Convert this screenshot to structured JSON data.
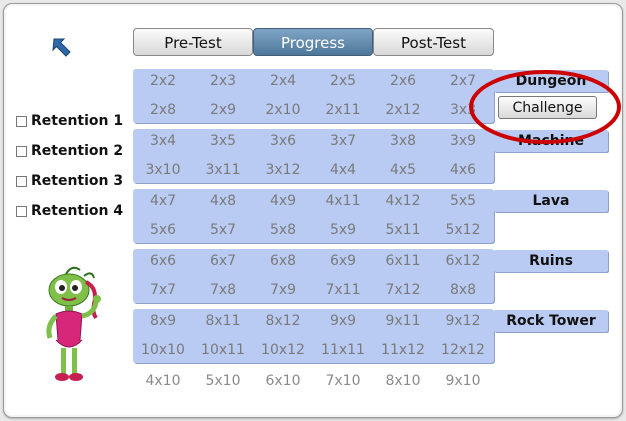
{
  "tabs": [
    {
      "label": "Pre-Test",
      "active": false
    },
    {
      "label": "Progress",
      "active": true
    },
    {
      "label": "Post-Test",
      "active": false
    }
  ],
  "retention": [
    "Retention 1",
    "Retention 2",
    "Retention 3",
    "Retention 4"
  ],
  "groups": [
    {
      "label": "Dungeon",
      "row1": [
        "2x2",
        "2x3",
        "2x4",
        "2x5",
        "2x6",
        "2x7"
      ],
      "row2": [
        "2x8",
        "2x9",
        "2x10",
        "2x11",
        "2x12",
        "3x3"
      ]
    },
    {
      "label": "Machine",
      "row1": [
        "3x4",
        "3x5",
        "3x6",
        "3x7",
        "3x8",
        "3x9"
      ],
      "row2": [
        "3x10",
        "3x11",
        "3x12",
        "4x4",
        "4x5",
        "4x6"
      ]
    },
    {
      "label": "Lava",
      "row1": [
        "4x7",
        "4x8",
        "4x9",
        "4x11",
        "4x12",
        "5x5"
      ],
      "row2": [
        "5x6",
        "5x7",
        "5x8",
        "5x9",
        "5x11",
        "5x12"
      ]
    },
    {
      "label": "Ruins",
      "row1": [
        "6x6",
        "6x7",
        "6x8",
        "6x9",
        "6x11",
        "6x12"
      ],
      "row2": [
        "7x7",
        "7x8",
        "7x9",
        "7x11",
        "7x12",
        "8x8"
      ]
    },
    {
      "label": "Rock Tower",
      "row1": [
        "8x9",
        "8x11",
        "8x12",
        "9x9",
        "9x11",
        "9x12"
      ],
      "row2": [
        "10x10",
        "10x11",
        "10x12",
        "11x11",
        "11x12",
        "12x12"
      ]
    }
  ],
  "bottom_row": [
    "4x10",
    "5x10",
    "6x10",
    "7x10",
    "8x10",
    "9x10"
  ],
  "challenge_label": "Challenge",
  "colors": {
    "group_bg": "#b9cbf2",
    "active_tab": "#5a84a8",
    "highlight": "#cc0000"
  }
}
